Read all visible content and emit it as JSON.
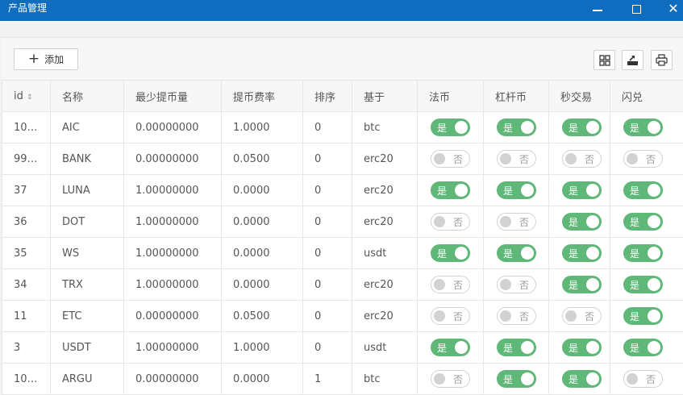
{
  "window": {
    "title": "产品管理"
  },
  "toolbar": {
    "add_label": "添加"
  },
  "table": {
    "headers": {
      "id": "id",
      "name": "名称",
      "min_withdraw": "最少提币量",
      "fee": "提币费率",
      "sort": "排序",
      "base": "基于",
      "fiat": "法币",
      "leverage": "杠杆币",
      "second": "秒交易",
      "flash": "闪兑"
    },
    "rows": [
      {
        "id": "10…",
        "name": "AIC",
        "min_withdraw": "0.00000000",
        "fee": "1.0000",
        "sort": "0",
        "base": "btc",
        "fiat": "是",
        "leverage": "是",
        "second": "是",
        "flash": "是"
      },
      {
        "id": "99…",
        "name": "BANK",
        "min_withdraw": "0.00000000",
        "fee": "0.0500",
        "sort": "0",
        "base": "erc20",
        "fiat": "否",
        "leverage": "否",
        "second": "否",
        "flash": "否"
      },
      {
        "id": "37",
        "name": "LUNA",
        "min_withdraw": "1.00000000",
        "fee": "0.0000",
        "sort": "0",
        "base": "erc20",
        "fiat": "是",
        "leverage": "是",
        "second": "是",
        "flash": "是"
      },
      {
        "id": "36",
        "name": "DOT",
        "min_withdraw": "1.00000000",
        "fee": "0.0000",
        "sort": "0",
        "base": "erc20",
        "fiat": "否",
        "leverage": "否",
        "second": "是",
        "flash": "是"
      },
      {
        "id": "35",
        "name": "WS",
        "min_withdraw": "1.00000000",
        "fee": "0.0000",
        "sort": "0",
        "base": "usdt",
        "fiat": "是",
        "leverage": "是",
        "second": "是",
        "flash": "是"
      },
      {
        "id": "34",
        "name": "TRX",
        "min_withdraw": "1.00000000",
        "fee": "0.0000",
        "sort": "0",
        "base": "erc20",
        "fiat": "否",
        "leverage": "否",
        "second": "是",
        "flash": "是"
      },
      {
        "id": "11",
        "name": "ETC",
        "min_withdraw": "0.00000000",
        "fee": "0.0500",
        "sort": "0",
        "base": "erc20",
        "fiat": "否",
        "leverage": "否",
        "second": "否",
        "flash": "是"
      },
      {
        "id": "3",
        "name": "USDT",
        "min_withdraw": "1.00000000",
        "fee": "1.0000",
        "sort": "0",
        "base": "usdt",
        "fiat": "是",
        "leverage": "是",
        "second": "是",
        "flash": "是"
      },
      {
        "id": "10…",
        "name": "ARGU",
        "min_withdraw": "0.00000000",
        "fee": "0.0000",
        "sort": "1",
        "base": "btc",
        "fiat": "否",
        "leverage": "是",
        "second": "是",
        "flash": "否"
      }
    ]
  },
  "colors": {
    "titlebar": "#0f6dbf",
    "switch_on": "#5fb878",
    "switch_off_border": "#d2d2d2"
  },
  "icons": {
    "columns": "grid-icon",
    "export": "export-icon",
    "print": "print-icon"
  }
}
